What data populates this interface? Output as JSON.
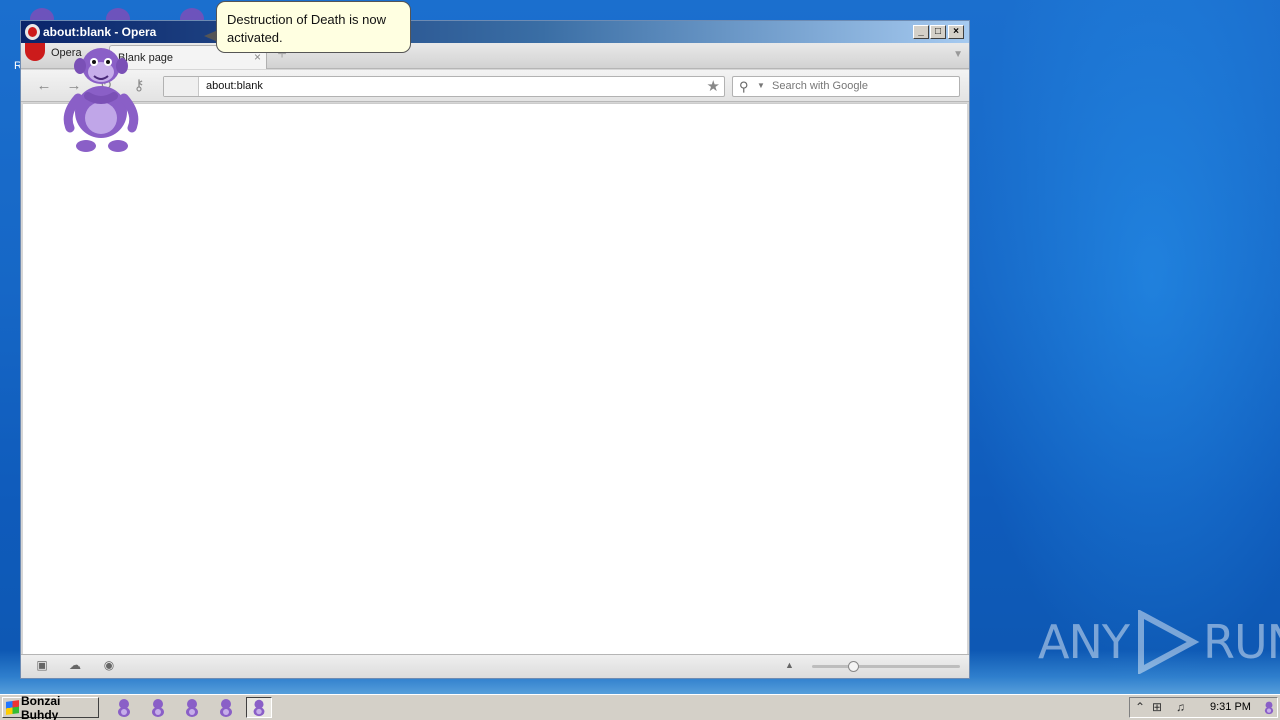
{
  "window": {
    "title": "about:blank - Opera",
    "minimize_label": "_",
    "maximize_label": "□",
    "close_label": "×"
  },
  "tabbar": {
    "menu_label": "Opera",
    "tabs": [
      {
        "label": "Blank page"
      }
    ],
    "close_label": "×",
    "new_tab_label": "+"
  },
  "toolbar": {
    "address_value": "about:blank",
    "search_placeholder": "Search with Google"
  },
  "balloon": {
    "text": "Destruction of Death is now activated."
  },
  "desktop": {
    "label_fragment": "R"
  },
  "taskbar": {
    "start_label": "Bonzai Buhdy",
    "item_count_note": "",
    "clock": "9:31 PM"
  },
  "watermark": {
    "left": "ANY",
    "right": "RUN"
  },
  "colors": {
    "desktop_blue": "#1667c6",
    "buddy_purple": "#8a5fc7",
    "balloon_bg": "#ffffe1"
  }
}
